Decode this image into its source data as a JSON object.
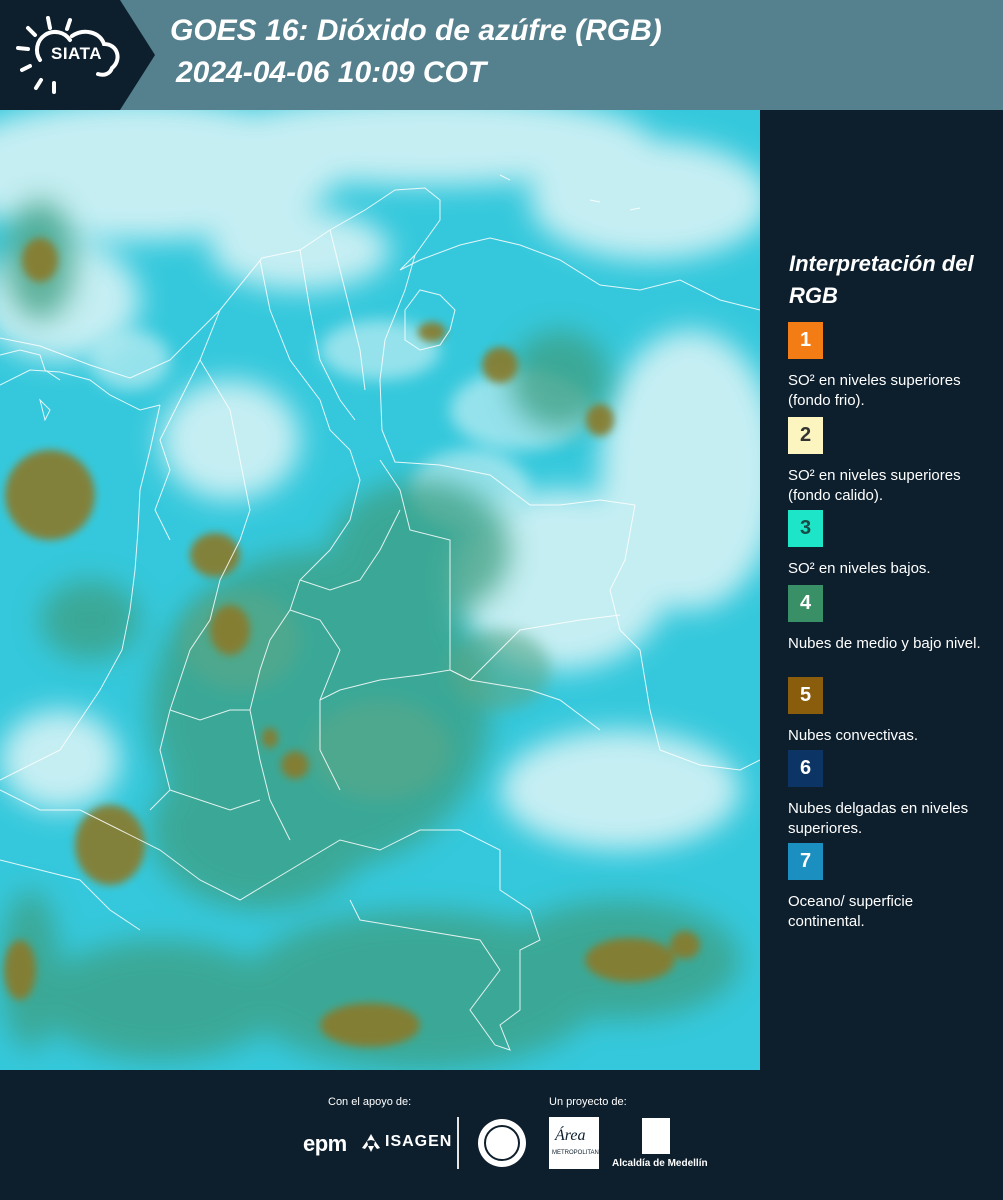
{
  "header": {
    "logo_text": "SIATA",
    "title_line1": "GOES 16: Dióxido de azúfre (RGB)",
    "title_line2": "2024-04-06 10:09 COT"
  },
  "legend": {
    "title": "Interpretación del RGB",
    "items": [
      {
        "number": "1",
        "color": "#f47c14",
        "text_color": "#ffffff",
        "text": "SO² en niveles superiores (fondo frio)."
      },
      {
        "number": "2",
        "color": "#fdf5c0",
        "text_color": "#333333",
        "text": "SO² en niveles superiores (fondo calido)."
      },
      {
        "number": "3",
        "color": "#1de5c8",
        "text_color": "#1a4a46",
        "text": "SO² en niveles bajos."
      },
      {
        "number": "4",
        "color": "#3a9066",
        "text_color": "#ffffff",
        "text": "Nubes de medio y bajo nivel."
      },
      {
        "number": "5",
        "color": "#8a5d0c",
        "text_color": "#ffffff",
        "text": "Nubes convectivas."
      },
      {
        "number": "6",
        "color": "#0c3464",
        "text_color": "#ffffff",
        "text": "Nubes delgadas en niveles superiores."
      },
      {
        "number": "7",
        "color": "#1b8fbf",
        "text_color": "#ffffff",
        "text": "Oceano/ superficie continental."
      }
    ]
  },
  "footer": {
    "support_label": "Con el apoyo de:",
    "project_label": "Un proyecto de:",
    "epm": "epm",
    "isagen": "ISAGEN",
    "area_logo": "Área",
    "area_sub": "METROPOLITANA",
    "alcaldia": "Alcaldía de Medellín"
  },
  "map": {
    "ocean_color": "#35c8dc",
    "cloud_color": "#d9f3f5",
    "low_cloud_color": "#3a9e7e",
    "convective_color": "#8a7a2c",
    "border_color": "#ffffff"
  }
}
